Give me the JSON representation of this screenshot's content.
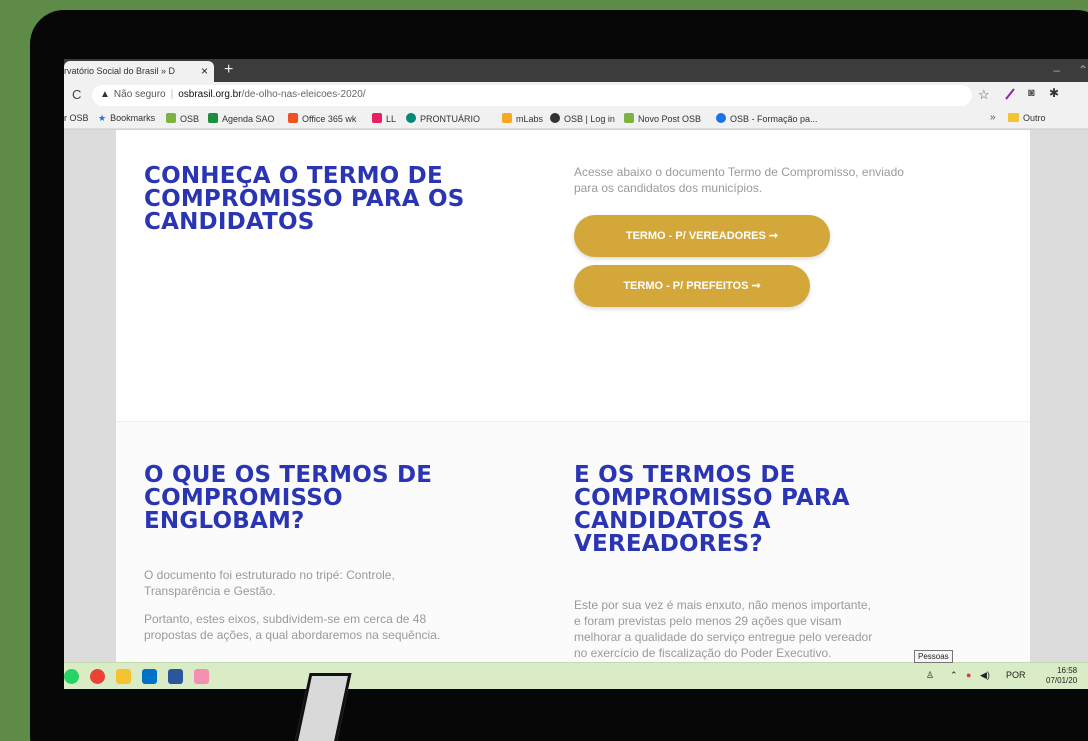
{
  "browser": {
    "tab_title": "rvatório Social do Brasil » D",
    "tab_close": "×",
    "new_tab": "+",
    "window_min": "–",
    "window_more": "⌃",
    "reload": "C",
    "security_label": "Não seguro",
    "url_host": "osbrasil.org.br",
    "url_path": "/de-olho-nas-eleicoes-2020/"
  },
  "bookmarks": {
    "items": [
      {
        "label": "r OSB"
      },
      {
        "label": "Bookmarks",
        "color": "#1a73e8"
      },
      {
        "label": "OSB",
        "color": "#7cb342"
      },
      {
        "label": "Agenda SAO",
        "color": "#1e8e3e"
      },
      {
        "label": "Office 365 wk",
        "color": "#f25022"
      },
      {
        "label": "LL",
        "color": "#e91e63"
      },
      {
        "label": "PRONTUÁRIO",
        "color": "#00897b"
      },
      {
        "label": "mLabs",
        "color": "#f9a825"
      },
      {
        "label": "OSB | Log in",
        "color": "#333333"
      },
      {
        "label": "Novo Post OSB",
        "color": "#7cb342"
      },
      {
        "label": "OSB - Formação pa...",
        "color": "#1a73e8"
      }
    ],
    "more": "»",
    "other_folder": "Outro"
  },
  "page": {
    "section1": {
      "heading": [
        "CONHEÇA O TERMO DE",
        "COMPROMISSO PARA OS",
        "CANDIDATOS"
      ],
      "description": [
        "Acesse abaixo o documento Termo de Compromisso, enviado",
        "para os candidatos dos municípios."
      ],
      "button_vereadores": "TERMO - P/ VEREADORES  ➞",
      "button_prefeitos": "TERMO - P/ PREFEITOS  ➞"
    },
    "section2_left": {
      "heading": [
        "O QUE OS TERMOS DE",
        "COMPROMISSO",
        "ENGLOBAM?"
      ],
      "para1": [
        "O documento foi estruturado no tripé: Controle,",
        "Transparência e Gestão."
      ],
      "para2": [
        "Portanto, estes eixos, subdividem-se em cerca de 48",
        "propostas de ações, a qual abordaremos na sequência."
      ]
    },
    "section2_right": {
      "heading": [
        "E OS TERMOS DE",
        "COMPROMISSO PARA",
        "CANDIDATOS A",
        "VEREADORES?"
      ],
      "para": [
        "Este por sua vez é mais enxuto, não menos importante,",
        "e foram previstas pelo menos 29 ações que visam",
        "melhorar a qualidade do serviço entregue pelo vereador",
        "no exercício de fiscalização do Poder Executivo."
      ]
    },
    "accent_color": "#2a35b3",
    "button_color": "#d3a73a"
  },
  "taskbar": {
    "tooltip": "Pessoas",
    "language": "POR",
    "time": "16:58",
    "date": "07/01/20"
  }
}
